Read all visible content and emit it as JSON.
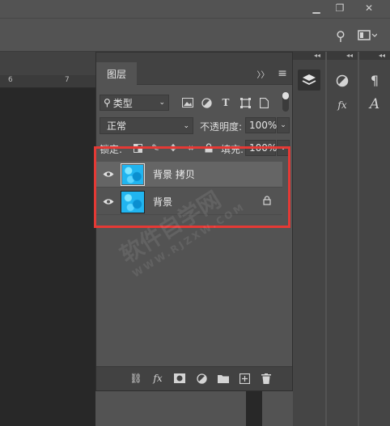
{
  "window": {
    "minimize_icon": "minimize-icon",
    "restore_icon": "restore-icon",
    "close_icon": "close-icon"
  },
  "options_bar": {
    "search_icon": "search-icon",
    "workspace_icon": "workspace-icon"
  },
  "ruler": {
    "ticks": [
      "6",
      "7"
    ]
  },
  "layers_panel": {
    "tab_label": "图层",
    "filter": {
      "value": "类型"
    },
    "blend_mode": {
      "value": "正常"
    },
    "opacity": {
      "label": "不透明度:",
      "value": "100%"
    },
    "lock": {
      "label": "锁定:"
    },
    "fill": {
      "label": "填充:",
      "value": "100%"
    },
    "layers": [
      {
        "name": "背景 拷贝",
        "visible": true,
        "selected": true,
        "locked": false
      },
      {
        "name": "背景",
        "visible": true,
        "selected": false,
        "locked": true
      }
    ]
  },
  "watermark": {
    "text": "软件自学网",
    "url": "WWW.RJZXW.COM"
  },
  "highlight_color": "#e53935"
}
